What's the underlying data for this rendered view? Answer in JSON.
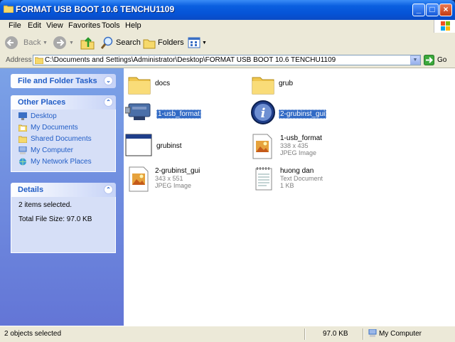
{
  "window": {
    "title": "FORMAT USB BOOT 10.6 TENCHU1109"
  },
  "menu": [
    "File",
    "Edit",
    "View",
    "Favorites",
    "Tools",
    "Help"
  ],
  "toolbar": {
    "back": "Back",
    "search": "Search",
    "folders": "Folders"
  },
  "address": {
    "label": "Address",
    "path": "C:\\Documents and Settings\\Administrator\\Desktop\\FORMAT USB BOOT 10.6 TENCHU1109",
    "go": "Go"
  },
  "left": {
    "tasks_title": "File and Folder Tasks",
    "places_title": "Other Places",
    "places": [
      "Desktop",
      "My Documents",
      "Shared Documents",
      "My Computer",
      "My Network Places"
    ],
    "details_title": "Details",
    "details_selected": "2 items selected.",
    "details_size": "Total File Size: 97.0 KB"
  },
  "files": [
    {
      "name": "docs",
      "type": "folder"
    },
    {
      "name": "grub",
      "type": "folder"
    },
    {
      "name": "1-usb_format",
      "type": "usb-app",
      "selected": true
    },
    {
      "name": "2-grubinst_gui",
      "type": "info-app",
      "selected": true
    },
    {
      "name": "grubinst",
      "type": "window-app"
    },
    {
      "name": "1-usb_format",
      "line2": "338 x 435",
      "line3": "JPEG Image",
      "type": "jpeg"
    },
    {
      "name": "2-grubinst_gui",
      "line2": "343 x 551",
      "line3": "JPEG Image",
      "type": "jpeg"
    },
    {
      "name": "huong dan",
      "line2": "Text Document",
      "line3": "1 KB",
      "type": "text"
    }
  ],
  "status": {
    "objects": "2 objects selected",
    "size": "97.0 KB",
    "location": "My Computer"
  }
}
